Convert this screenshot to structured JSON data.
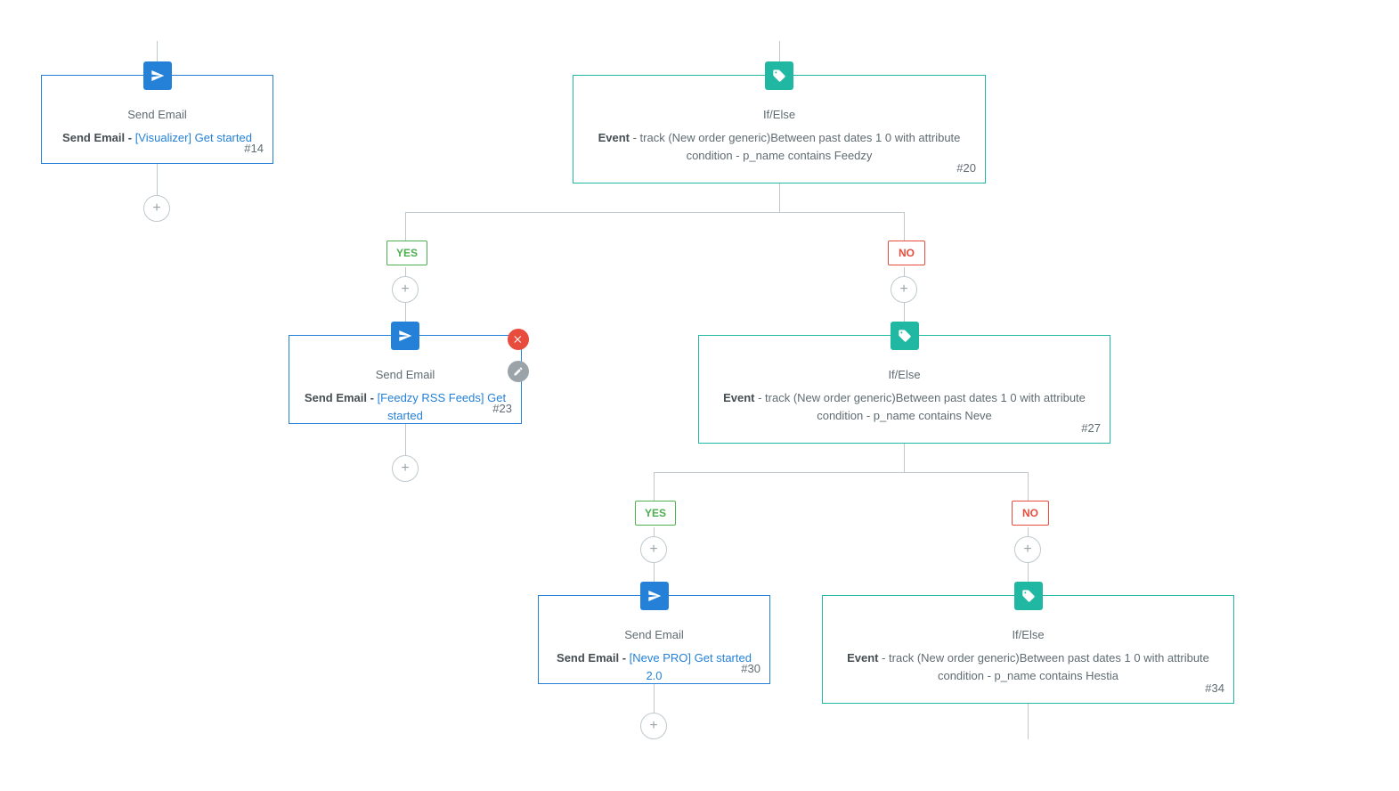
{
  "labels": {
    "yes": "YES",
    "no": "NO",
    "plus": "+"
  },
  "nodes": {
    "n14": {
      "type": "email",
      "title": "Send Email",
      "prefix": "Send Email - ",
      "link": "[Visualizer] Get started",
      "id": "#14"
    },
    "n20": {
      "type": "cond",
      "title": "If/Else",
      "prefix": "Event",
      "rest": " - track (New order generic)Between past dates 1 0 with attribute condition - p_name contains Feedzy",
      "id": "#20"
    },
    "n23": {
      "type": "email",
      "title": "Send Email",
      "prefix": "Send Email - ",
      "link": "[Feedzy RSS Feeds] Get started",
      "id": "#23"
    },
    "n27": {
      "type": "cond",
      "title": "If/Else",
      "prefix": "Event",
      "rest": " - track (New order generic)Between past dates 1 0 with attribute condition - p_name contains Neve",
      "id": "#27"
    },
    "n30": {
      "type": "email",
      "title": "Send Email",
      "prefix": "Send Email - ",
      "link": "[Neve PRO] Get started 2.0",
      "id": "#30"
    },
    "n34": {
      "type": "cond",
      "title": "If/Else",
      "prefix": "Event",
      "rest": " - track (New order generic)Between past dates 1 0 with attribute condition - p_name contains Hestia",
      "id": "#34"
    }
  }
}
